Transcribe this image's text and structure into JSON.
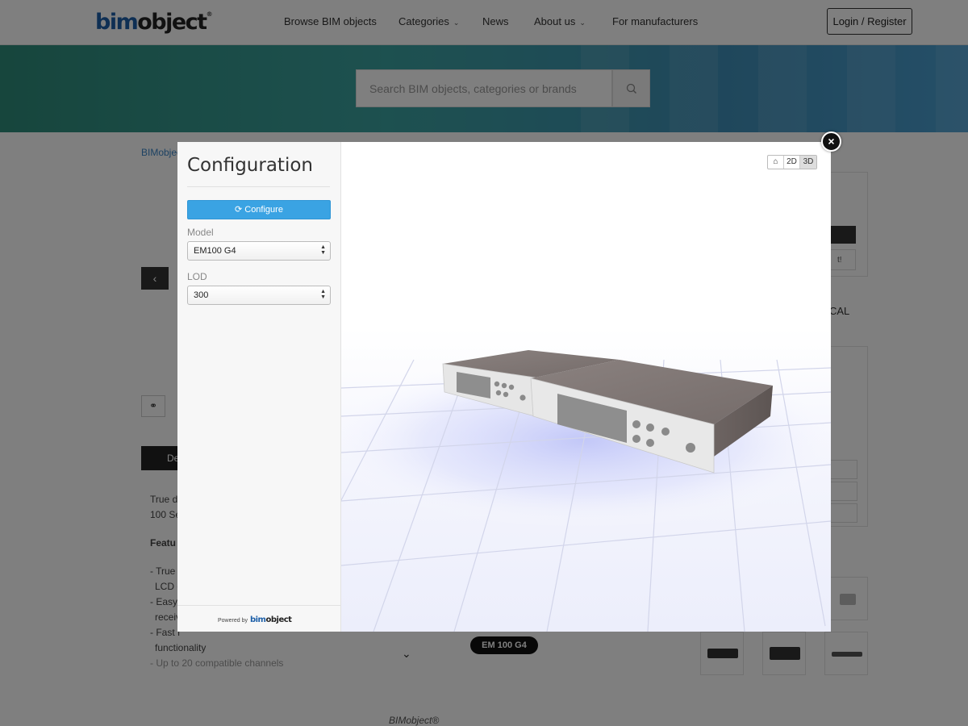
{
  "site": {
    "logo_bim": "bim",
    "logo_object": "object",
    "logo_reg": "®",
    "nav": {
      "browse": "Browse BIM objects",
      "categories": "Categories",
      "news": "News",
      "about": "About us",
      "manufacturers": "For manufacturers"
    },
    "login": "Login / Register",
    "search_placeholder": "Search BIM objects, categories or brands",
    "breadcrumb": "BIMobject",
    "details_tab": "De",
    "description": {
      "intro_1": "True d",
      "intro_2": "100 Se",
      "features": "Featu",
      "item_1a": "- True",
      "item_1b": "LCD d",
      "item_2a": "- Easy",
      "item_2b": "receiv",
      "item_3a": "- Fast f",
      "item_3b": "functionality",
      "item_4": "- Up to 20 compatible channels"
    },
    "model_pill": "EM 100 G4",
    "footer": "BIMobject®",
    "right_partial_text": "CAL",
    "right_partial_btn": "t!"
  },
  "modal": {
    "title": "Configuration",
    "configure_label": "Configure",
    "model_label": "Model",
    "model_value": "EM100 G4",
    "lod_label": "LOD",
    "lod_value": "300",
    "powered_by": "Powered by",
    "powered_logo_bim": "bim",
    "powered_logo_object": "object",
    "view_2d": "2D",
    "view_3d": "3D",
    "view_active": "3D"
  },
  "colors": {
    "accent": "#3aa3e3",
    "brand_blue": "#1d5fa8",
    "device_top": "#7d7472",
    "device_front": "#e6e6e6",
    "floor_glow": "#c8cdfa"
  }
}
